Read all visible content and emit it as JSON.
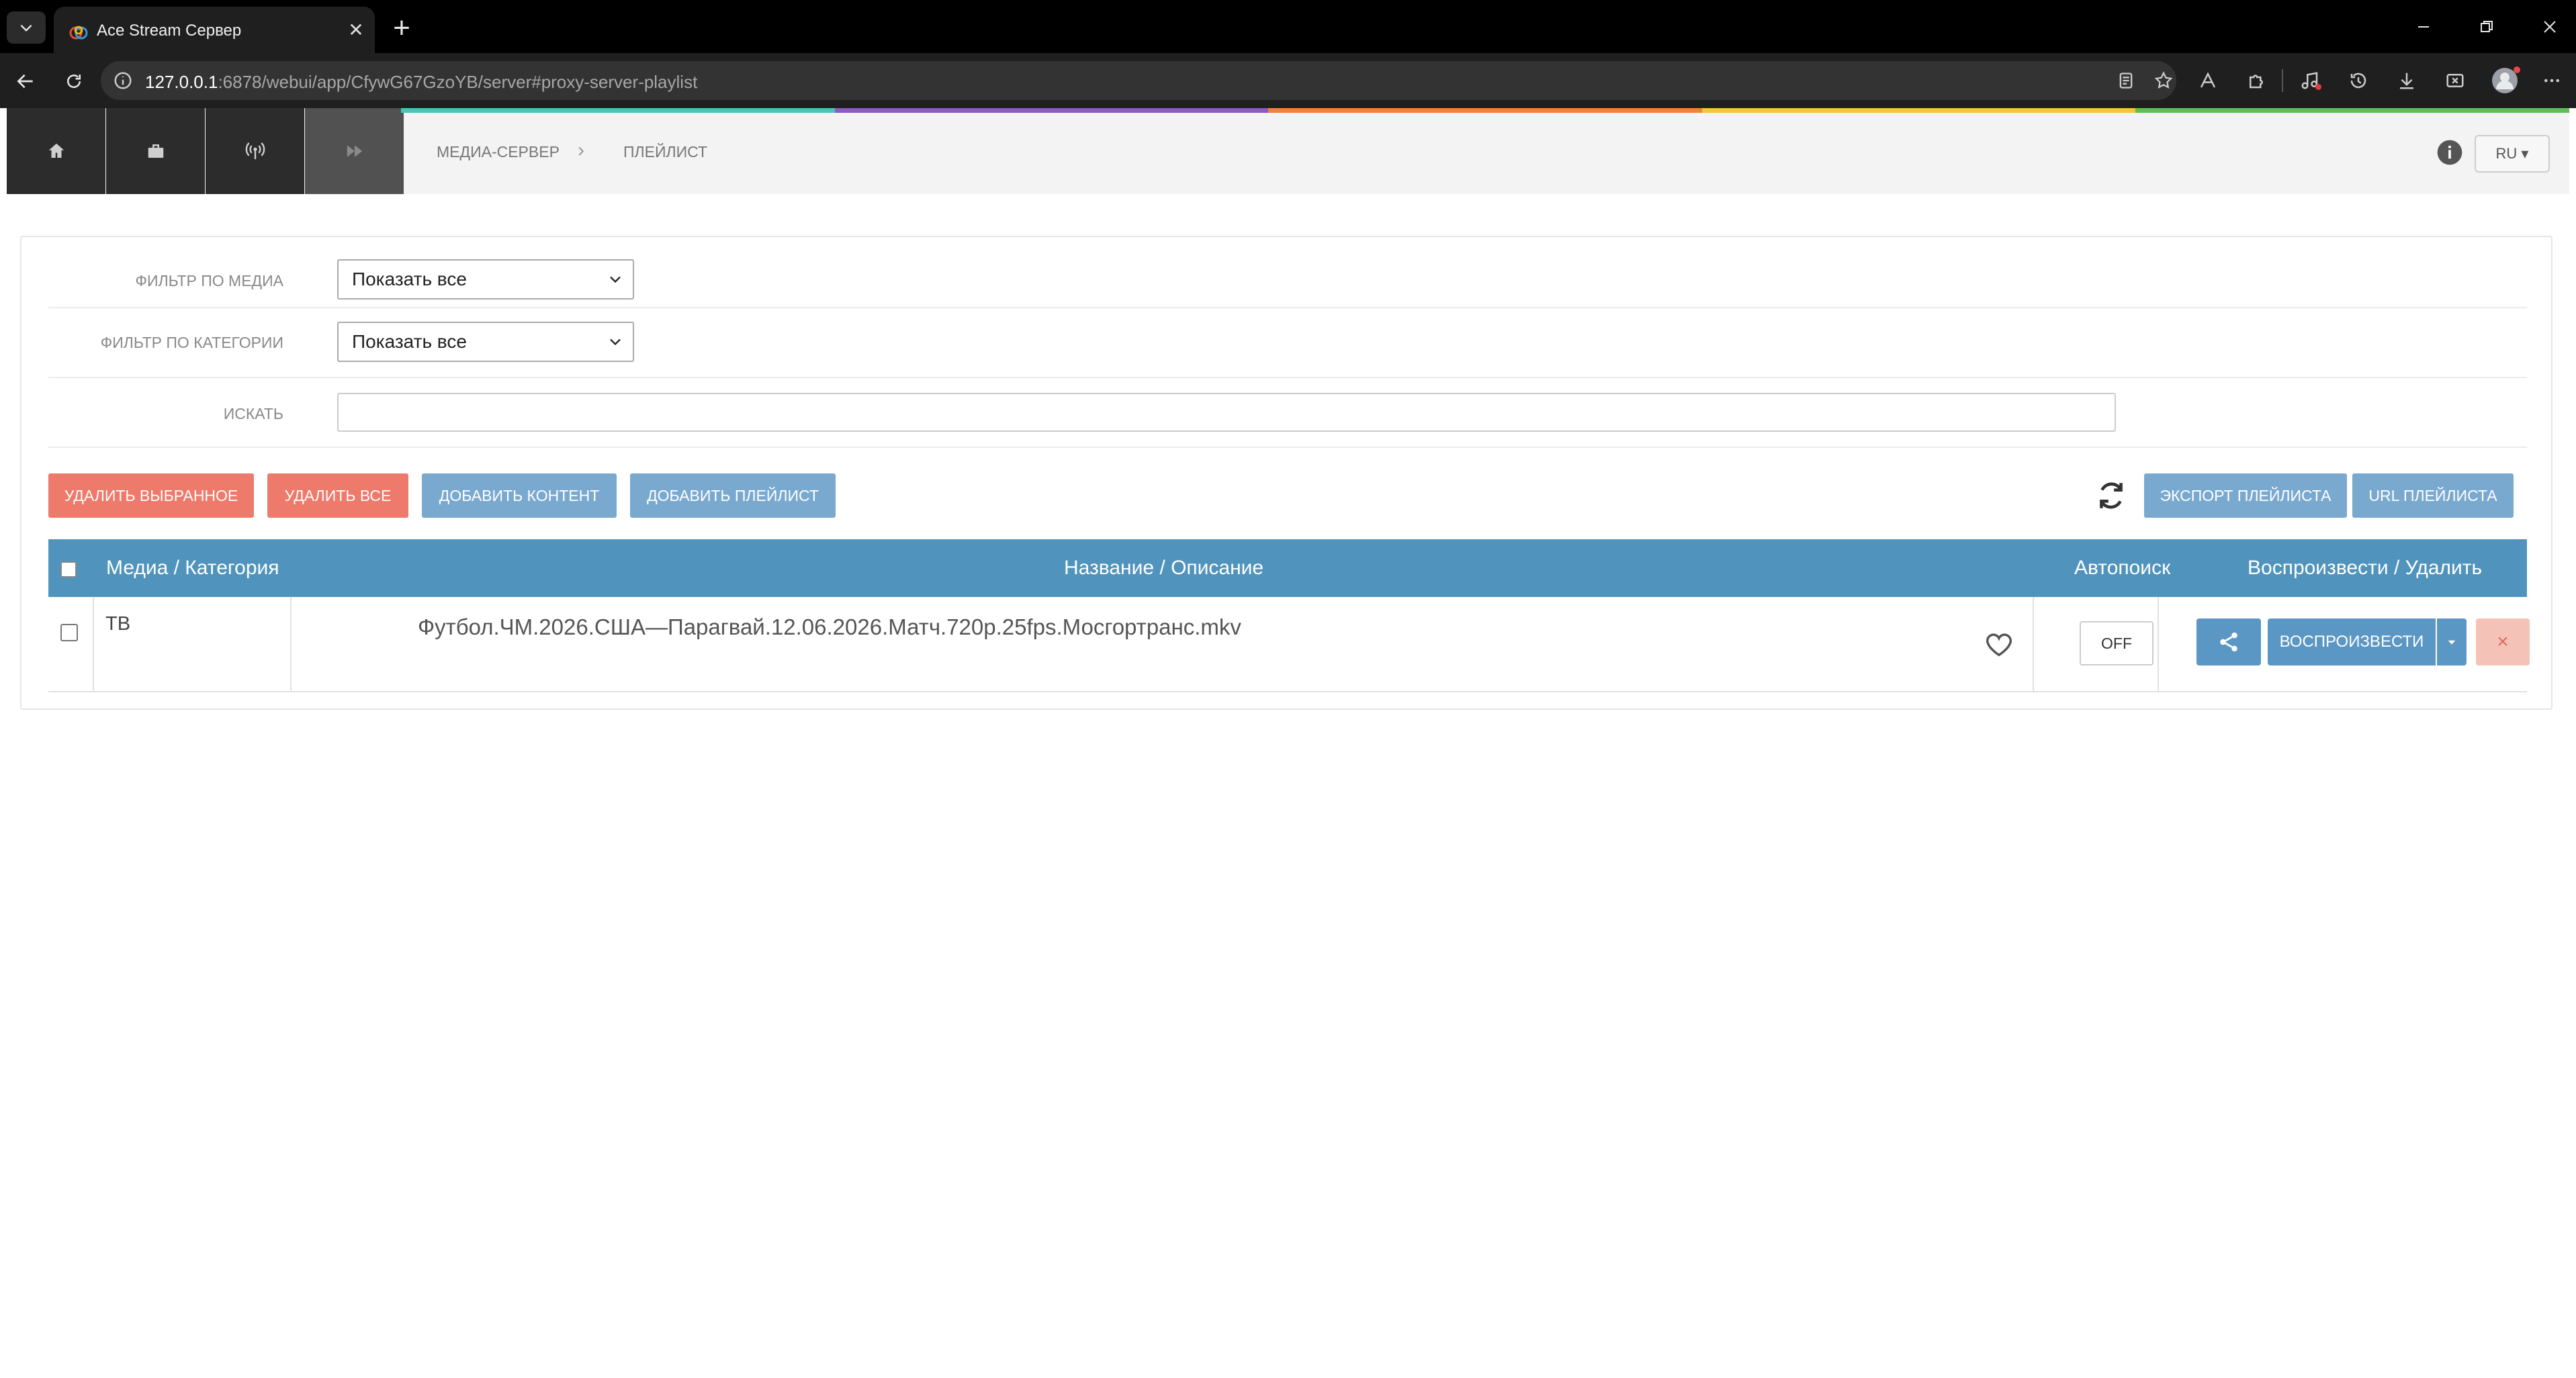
{
  "browser": {
    "tab_title": "Ace Stream Сервер",
    "url_host": "127.0.0.1",
    "url_rest": ":6878/webui/app/CfywG67GzoYB/server#proxy-server-playlist"
  },
  "header": {
    "nav_tiles": [
      "home-icon",
      "briefcase-icon",
      "broadcast-icon",
      "fast-forward-icon"
    ],
    "breadcrumb": [
      "МЕДИА-СЕРВЕР",
      "ПЛЕЙЛИСТ"
    ],
    "language": "RU ▾",
    "color_bar": [
      "#4dc3b5",
      "#8e5bc4",
      "#f2813d",
      "#f6c53b",
      "#5fc05a"
    ]
  },
  "filters": {
    "media_label": "ФИЛЬТР ПО МЕДИА",
    "media_value": "Показать все",
    "category_label": "ФИЛЬТР ПО КАТЕГОРИИ",
    "category_value": "Показать все",
    "search_label": "ИСКАТЬ",
    "search_value": ""
  },
  "actions": {
    "delete_selected": "УДАЛИТЬ ВЫБРАННОЕ",
    "delete_all": "УДАЛИТЬ ВСЕ",
    "add_content": "ДОБАВИТЬ КОНТЕНТ",
    "add_playlist": "ДОБАВИТЬ ПЛЕЙЛИСТ",
    "export_playlist": "ЭКСПОРТ ПЛЕЙЛИСТА",
    "playlist_url": "URL ПЛЕЙЛИСТА"
  },
  "table": {
    "columns": [
      "Медиа / Категория",
      "Название / Описание",
      "Автопоиск",
      "Воспроизвести / Удалить"
    ],
    "rows": [
      {
        "category": "ТВ",
        "title": "Футбол.ЧМ.2026.США—Парагвай.12.06.2026.Матч.720p.25fps.Мосгортранс.mkv",
        "autosearch": "OFF",
        "play_label": "ВОСПРОИЗВЕСТИ",
        "delete_label": "×"
      }
    ]
  }
}
